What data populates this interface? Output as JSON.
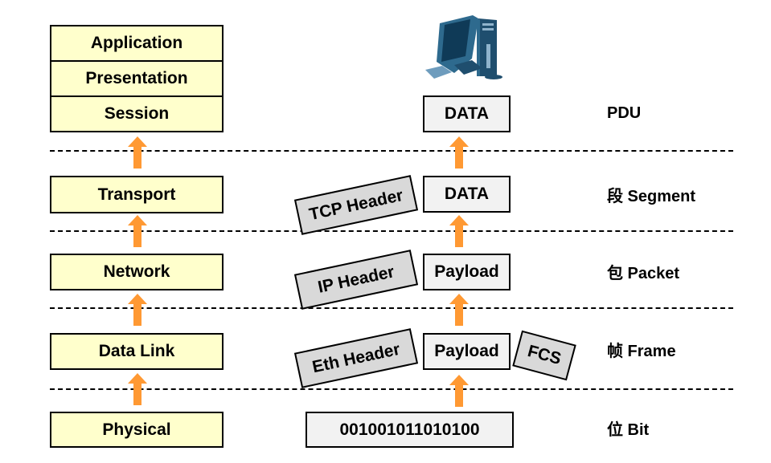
{
  "layers": [
    "Application",
    "Presentation",
    "Session",
    "Transport",
    "Network",
    "Data Link",
    "Physical"
  ],
  "pdu_boxes": {
    "data_top": "DATA",
    "data_transport": "DATA",
    "payload_network": "Payload",
    "payload_datalink": "Payload",
    "bits": "001001011010100"
  },
  "headers": {
    "tcp": "TCP Header",
    "ip": "IP Header",
    "eth": "Eth Header",
    "fcs": "FCS"
  },
  "pdu_labels": {
    "title": "PDU",
    "segment": "段 Segment",
    "packet": "包 Packet",
    "frame": "帧 Frame",
    "bit": "位 Bit"
  },
  "icons": {
    "computer": "desktop-computer-icon",
    "arrow": "arrow-up-icon"
  },
  "colors": {
    "layer_fill": "#FFFFCC",
    "pdu_fill": "#F2F2F2",
    "header_fill": "#D9D9D9",
    "arrow": "#FF9933",
    "computer": "#1F4E6E"
  }
}
